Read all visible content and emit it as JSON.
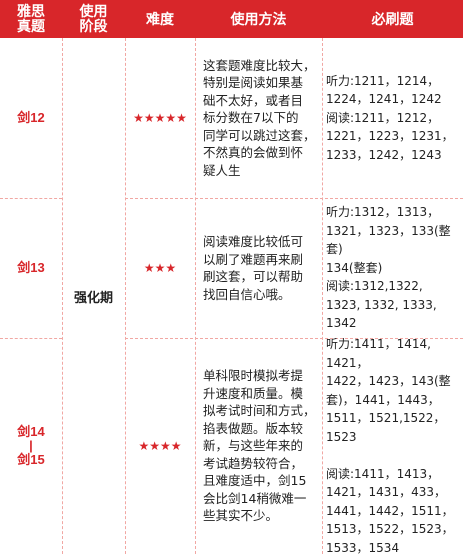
{
  "header": {
    "exam": "雅思\n真题",
    "stage": "使用\n阶段",
    "difficulty": "难度",
    "method": "使用方法",
    "must": "必刷题"
  },
  "stage_label": "强化期",
  "rows": [
    {
      "exam": "剑12",
      "stars": "★★★★★",
      "method": "这套题难度比较大，\n特别是阅读如果基\n础不太好，或者目\n标分数在7以下的\n同学可以跳过这套，\n不然真的会做到怀\n疑人生",
      "must": "听力:1211，1214，\n1224，1241，1242\n阅读:1211，1212，\n1221，1223，1231，\n1233，1242，1243"
    },
    {
      "exam": "剑13",
      "stars": "★★★",
      "method": "阅读难度比较低可\n以刷了难题再来刷\n刷这套，可以帮助\n找回自信心哦。",
      "must": "听力:1312，1313，\n1321，1323，133(整套)\n134(整套)\n阅读:1312,1322,\n1323, 1332, 1333,\n1342"
    },
    {
      "exam": "剑14\n|\n剑15",
      "stars": "★★★★",
      "method": "单科限时模拟考提\n升速度和质量。模\n拟考试时间和方式，\n掐表做题。版本较\n新，与这些年来的\n考试趋势较符合，\n且难度适中，剑15\n会比剑14稍微难一\n些其实不少。",
      "must": "听力:1411，1414, 1421，\n1422，1423，143(整\n套)，1441，1443，\n1511，1521,1522，\n1523\n\n阅读:1411，1413，\n1421，1431，433，\n1441，1442，1511，\n1513，1522，1523，\n1533，1534"
    }
  ]
}
